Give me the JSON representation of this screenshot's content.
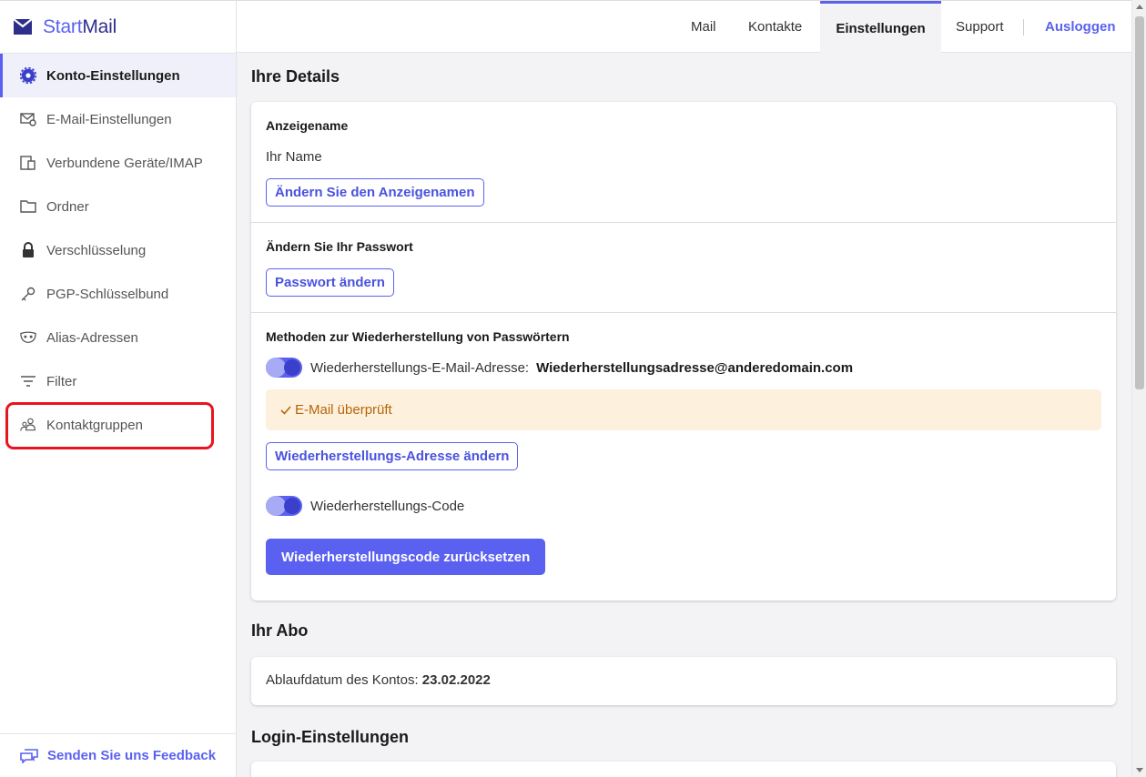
{
  "app": {
    "logo_start": "Start",
    "logo_mail": "Mail"
  },
  "colors": {
    "accent": "#5a61f0",
    "highlight_box": "#e8141e",
    "verified_bg": "#fdf0dc",
    "verified_text": "#b5650a"
  },
  "sidebar": {
    "items": [
      {
        "label": "Konto-Einstellungen",
        "icon": "gear-icon",
        "active": true
      },
      {
        "label": "E-Mail-Einstellungen",
        "icon": "mail-settings-icon"
      },
      {
        "label": "Verbundene Geräte/IMAP",
        "icon": "devices-icon"
      },
      {
        "label": "Ordner",
        "icon": "folder-icon"
      },
      {
        "label": "Verschlüsselung",
        "icon": "lock-icon"
      },
      {
        "label": "PGP-Schlüsselbund",
        "icon": "key-icon"
      },
      {
        "label": "Alias-Adressen",
        "icon": "mask-icon"
      },
      {
        "label": "Filter",
        "icon": "filter-icon"
      },
      {
        "label": "Kontaktgruppen",
        "icon": "contact-group-icon",
        "highlighted": true
      }
    ],
    "feedback_label": "Senden Sie uns Feedback"
  },
  "topnav": {
    "mail": "Mail",
    "contacts": "Kontakte",
    "settings": "Einstellungen",
    "support": "Support",
    "logout": "Ausloggen"
  },
  "details": {
    "title": "Ihre Details",
    "display_name_heading": "Anzeigename",
    "display_name_value": "Ihr Name",
    "change_display_name_button": "Ändern Sie den Anzeigenamen",
    "password_heading": "Ändern Sie Ihr Passwort",
    "change_password_button": "Passwort ändern",
    "recovery_heading": "Methoden zur Wiederherstellung von Passwörtern",
    "recovery_email_label": "Wiederherstellungs-E-Mail-Adresse:",
    "recovery_email_value": "Wiederherstellungsadresse@anderedomain.com",
    "recovery_email_enabled": true,
    "verified_text": "E-Mail überprüft",
    "change_recovery_address_button": "Wiederherstellungs-Adresse ändern",
    "recovery_code_label": "Wiederherstellungs-Code",
    "recovery_code_enabled": true,
    "reset_recovery_code_button": "Wiederherstellungscode zurücksetzen"
  },
  "subscription": {
    "title": "Ihr Abo",
    "expiry_label": "Ablaufdatum des Kontos:",
    "expiry_value": "23.02.2022"
  },
  "login_settings": {
    "title": "Login-Einstellungen"
  }
}
